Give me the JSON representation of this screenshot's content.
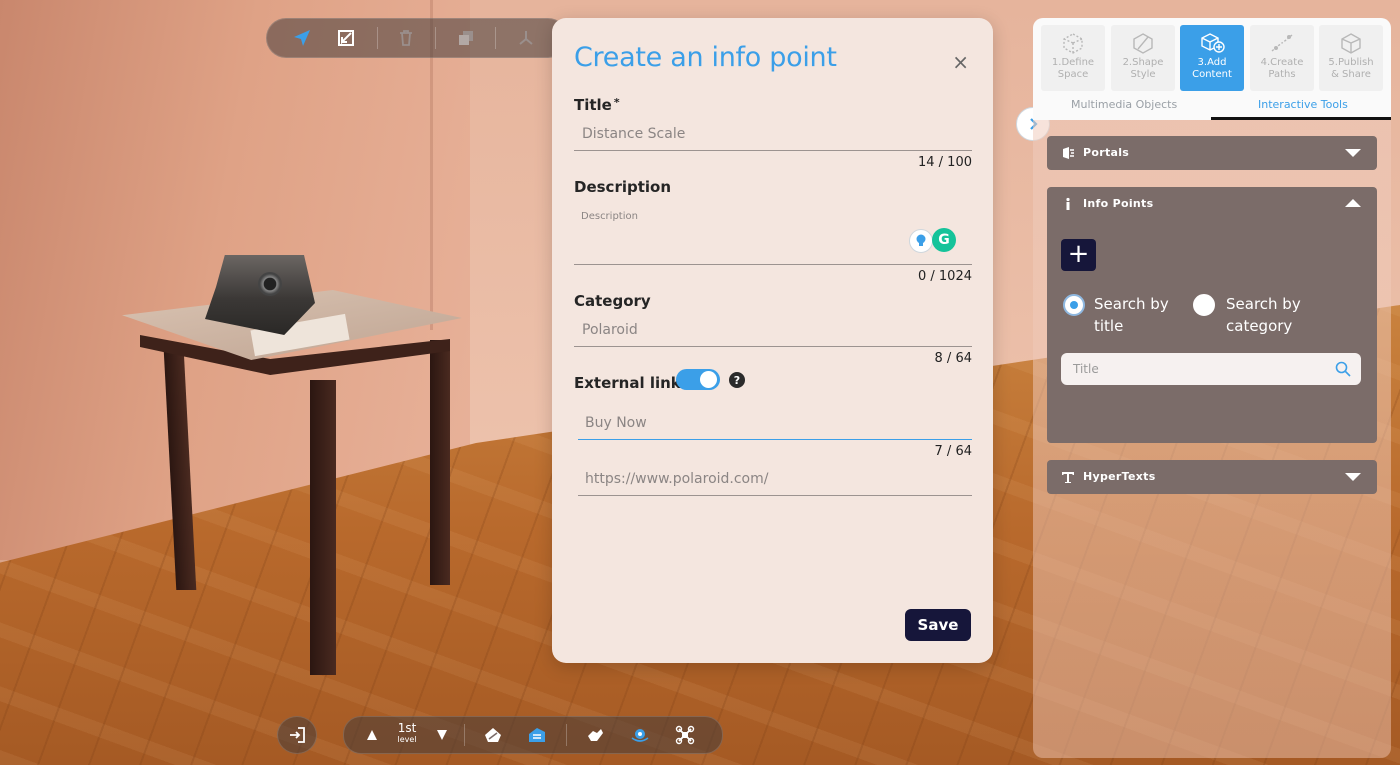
{
  "modal": {
    "title": "Create an info point",
    "close_label": "×",
    "title_field": {
      "label": "Title",
      "required_mark": "*",
      "value": "Distance Scale",
      "counter": "14 / 100"
    },
    "description_field": {
      "label": "Description",
      "placeholder": "Description",
      "counter": "0 / 1024"
    },
    "category_field": {
      "label": "Category",
      "value": "Polaroid",
      "counter": "8 / 64"
    },
    "external_link": {
      "label": "External link",
      "enabled": true,
      "help_label": "?",
      "link_text": {
        "value": "Buy Now",
        "counter": "7 / 64"
      },
      "url": {
        "value": "https://www.polaroid.com/"
      }
    },
    "save_label": "Save"
  },
  "steps": [
    {
      "label_line1": "1.Define",
      "label_line2": "Space",
      "active": false
    },
    {
      "label_line1": "2.Shape",
      "label_line2": "Style",
      "active": false
    },
    {
      "label_line1": "3.Add",
      "label_line2": "Content",
      "active": true
    },
    {
      "label_line1": "4.Create",
      "label_line2": "Paths",
      "active": false
    },
    {
      "label_line1": "5.Publish",
      "label_line2": "& Share",
      "active": false
    }
  ],
  "subtabs": [
    {
      "label": "Multimedia Objects",
      "active": false
    },
    {
      "label": "Interactive Tools",
      "active": true
    }
  ],
  "sections": {
    "portals": {
      "label": "Portals",
      "expanded": false
    },
    "info_points": {
      "label": "Info Points",
      "expanded": true,
      "add_label": "+",
      "search_by_title": "Search by title",
      "search_by_title_l1": "Search by",
      "search_by_title_l2": "title",
      "search_by_category_l1": "Search by",
      "search_by_category_l2": "category",
      "selected_search": "title",
      "search_placeholder": "Title"
    },
    "hypertexts": {
      "label": "HyperTexts",
      "expanded": false
    }
  },
  "bottom_toolbar": {
    "level_value": "1st",
    "level_label": "level"
  },
  "colors": {
    "accent": "#3b9fe8",
    "dark_button": "#16163a",
    "panel_section": "#7b6c69"
  },
  "icons": {
    "top_toolbar": [
      "navigate-arrow-icon",
      "select-box-icon",
      "trash-icon",
      "duplicate-icon",
      "axes-icon"
    ],
    "bottom_toolbar": [
      "exit-icon",
      "level-up-icon",
      "level-down-icon",
      "home-view-icon",
      "floorplan-icon",
      "hand-icon",
      "camera-360-icon",
      "drone-icon"
    ]
  }
}
